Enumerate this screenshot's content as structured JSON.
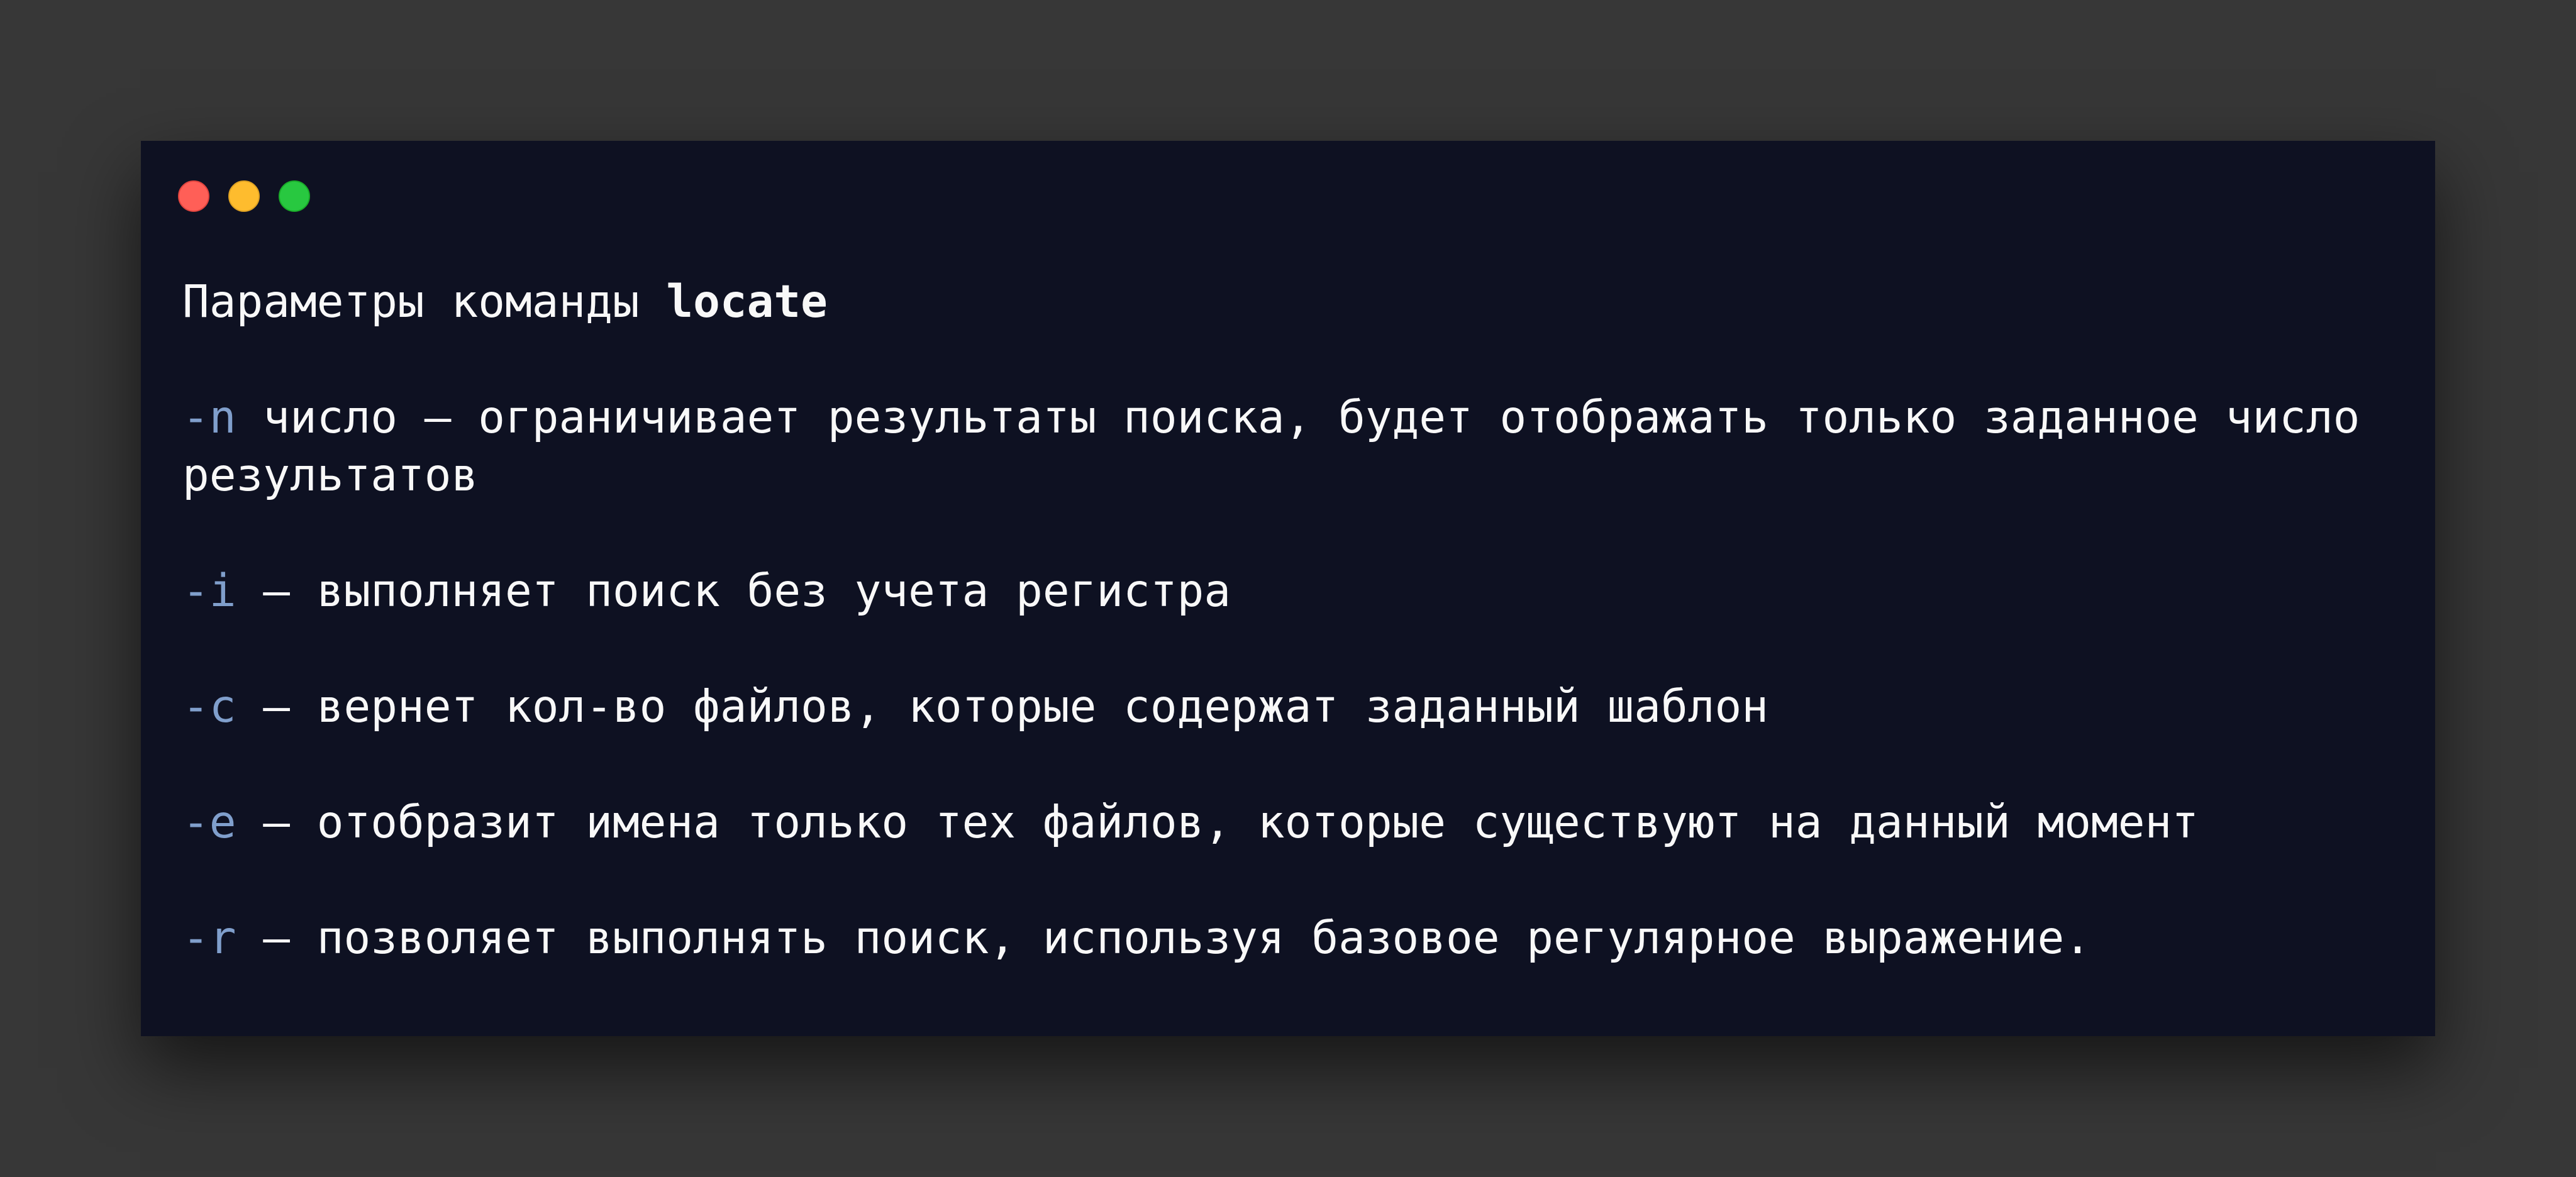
{
  "window": {
    "controls": [
      {
        "name": "close",
        "color": "#ff5f57",
        "border": "#e0443e"
      },
      {
        "name": "minimize",
        "color": "#febc2e",
        "border": "#dea123"
      },
      {
        "name": "zoom",
        "color": "#28c840",
        "border": "#1aab29"
      }
    ]
  },
  "colors": {
    "background": "#373737",
    "window": "#0e1122",
    "text": "#f8f8f8",
    "option": "#809fcc"
  },
  "heading": {
    "text": "Параметры команды ",
    "command": "locate"
  },
  "options": [
    {
      "flag": "-n",
      "description": " число — ограничивает результаты поиска, будет отображать только заданное число результатов"
    },
    {
      "flag": "-i",
      "description": " — выполняет поиск без учета регистра"
    },
    {
      "flag": "-c",
      "description": " — вернет кол-во файлов, которые содержат заданный шаблон"
    },
    {
      "flag": "-e",
      "description": " — отобразит имена только тех файлов, которые существуют на данный момент"
    },
    {
      "flag": "-r",
      "description": " — позволяет выполнять поиск, используя базовое регулярное выражение."
    }
  ]
}
